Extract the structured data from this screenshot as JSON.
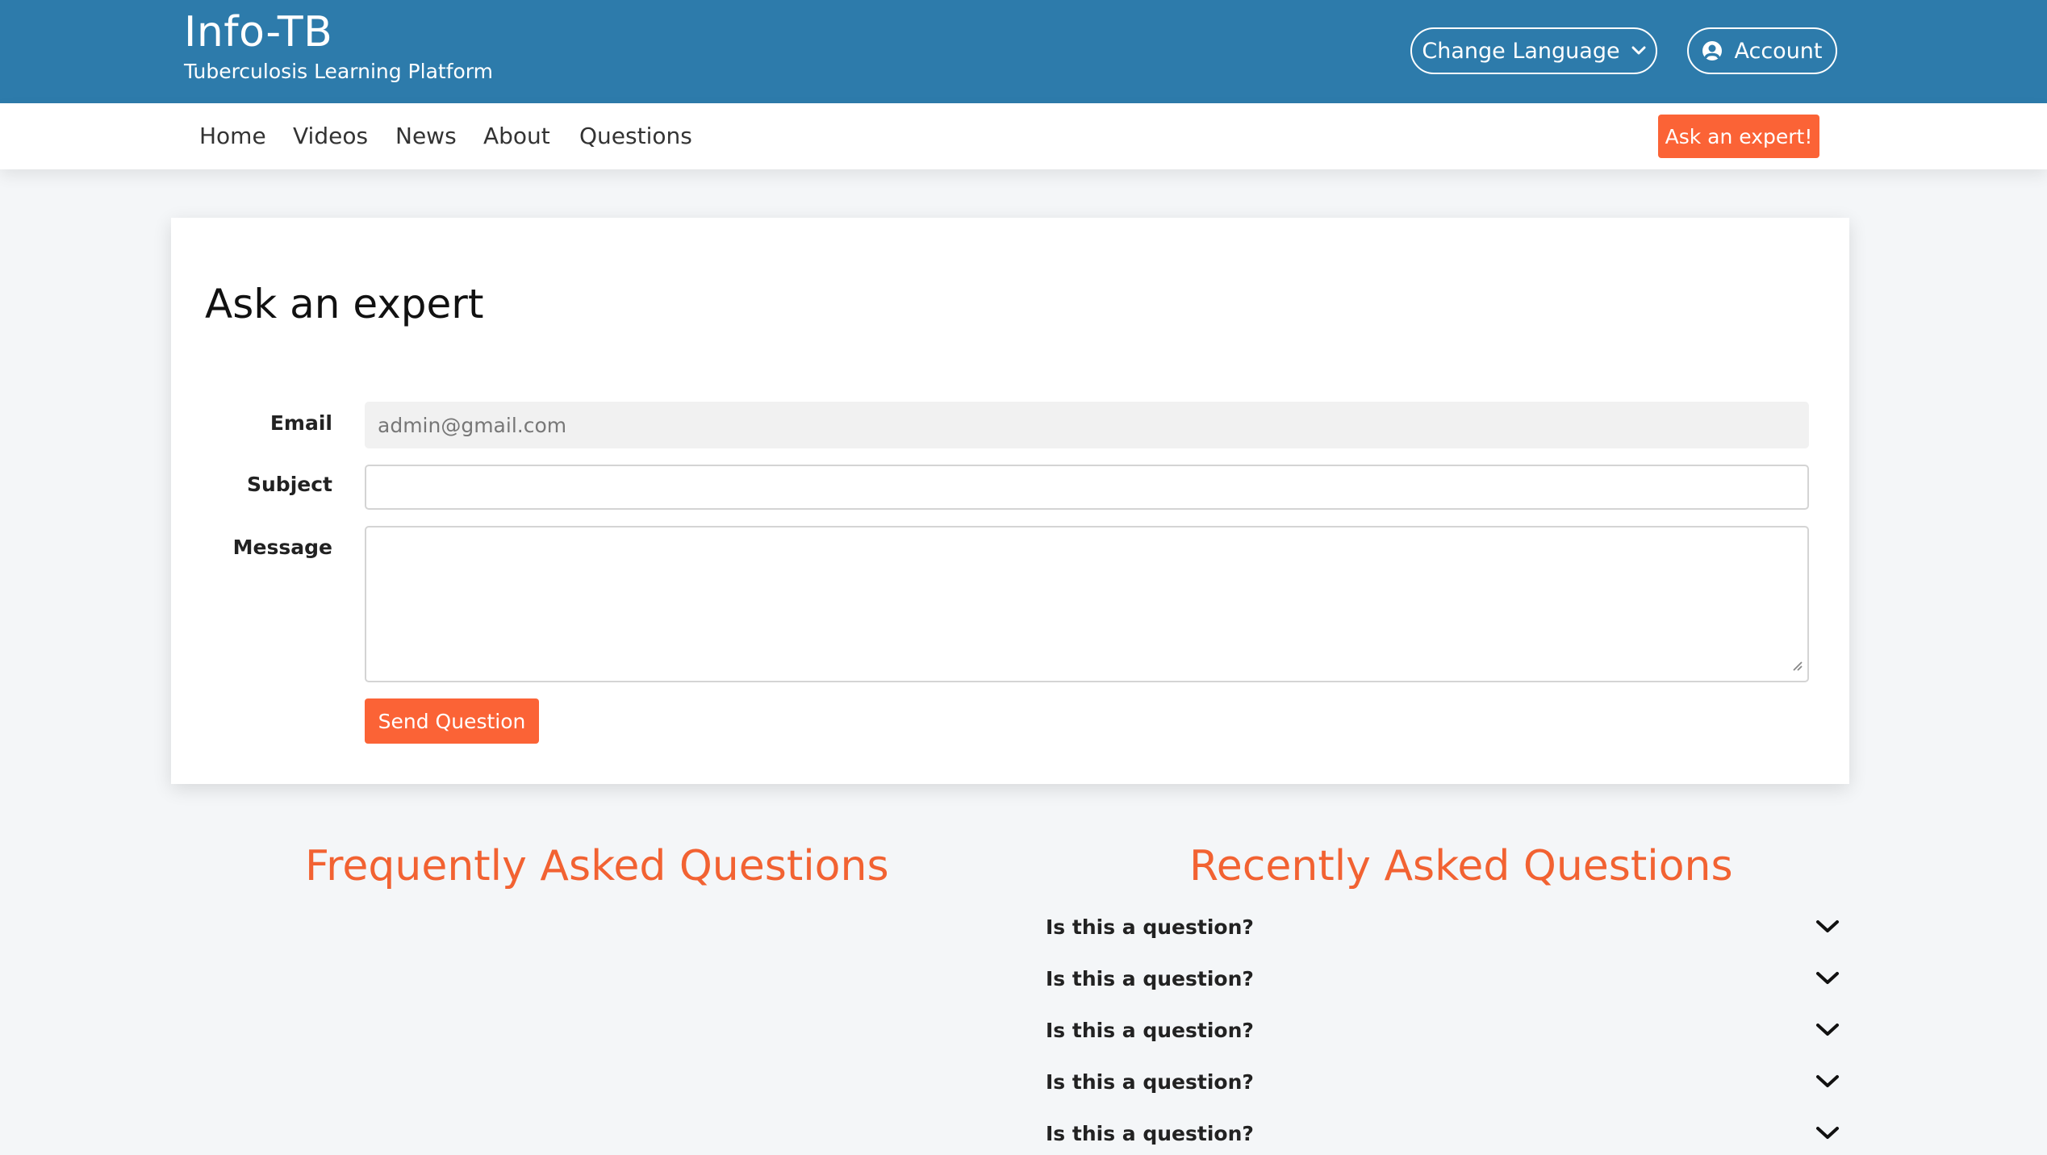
{
  "header": {
    "brand_title": "Info-TB",
    "brand_subtitle": "Tuberculosis Learning Platform",
    "language_button": "Change Language",
    "account_button": "Account"
  },
  "nav": {
    "items": [
      "Home",
      "Videos",
      "News",
      "About",
      "Questions"
    ],
    "cta": "Ask an expert!"
  },
  "form": {
    "title": "Ask an expert",
    "email_label": "Email",
    "email_value": "admin@gmail.com",
    "subject_label": "Subject",
    "subject_value": "",
    "message_label": "Message",
    "message_value": "",
    "submit_label": "Send Question"
  },
  "faq": {
    "title": "Frequently Asked Questions"
  },
  "recent": {
    "title": "Recently Asked Questions",
    "questions": [
      "Is this a question?",
      "Is this a question?",
      "Is this a question?",
      "Is this a question?",
      "Is this a question?"
    ]
  },
  "colors": {
    "header_bg": "#2d7bab",
    "accent": "#fb6336",
    "section_title": "#f26232",
    "page_bg": "#f4f6f8"
  }
}
